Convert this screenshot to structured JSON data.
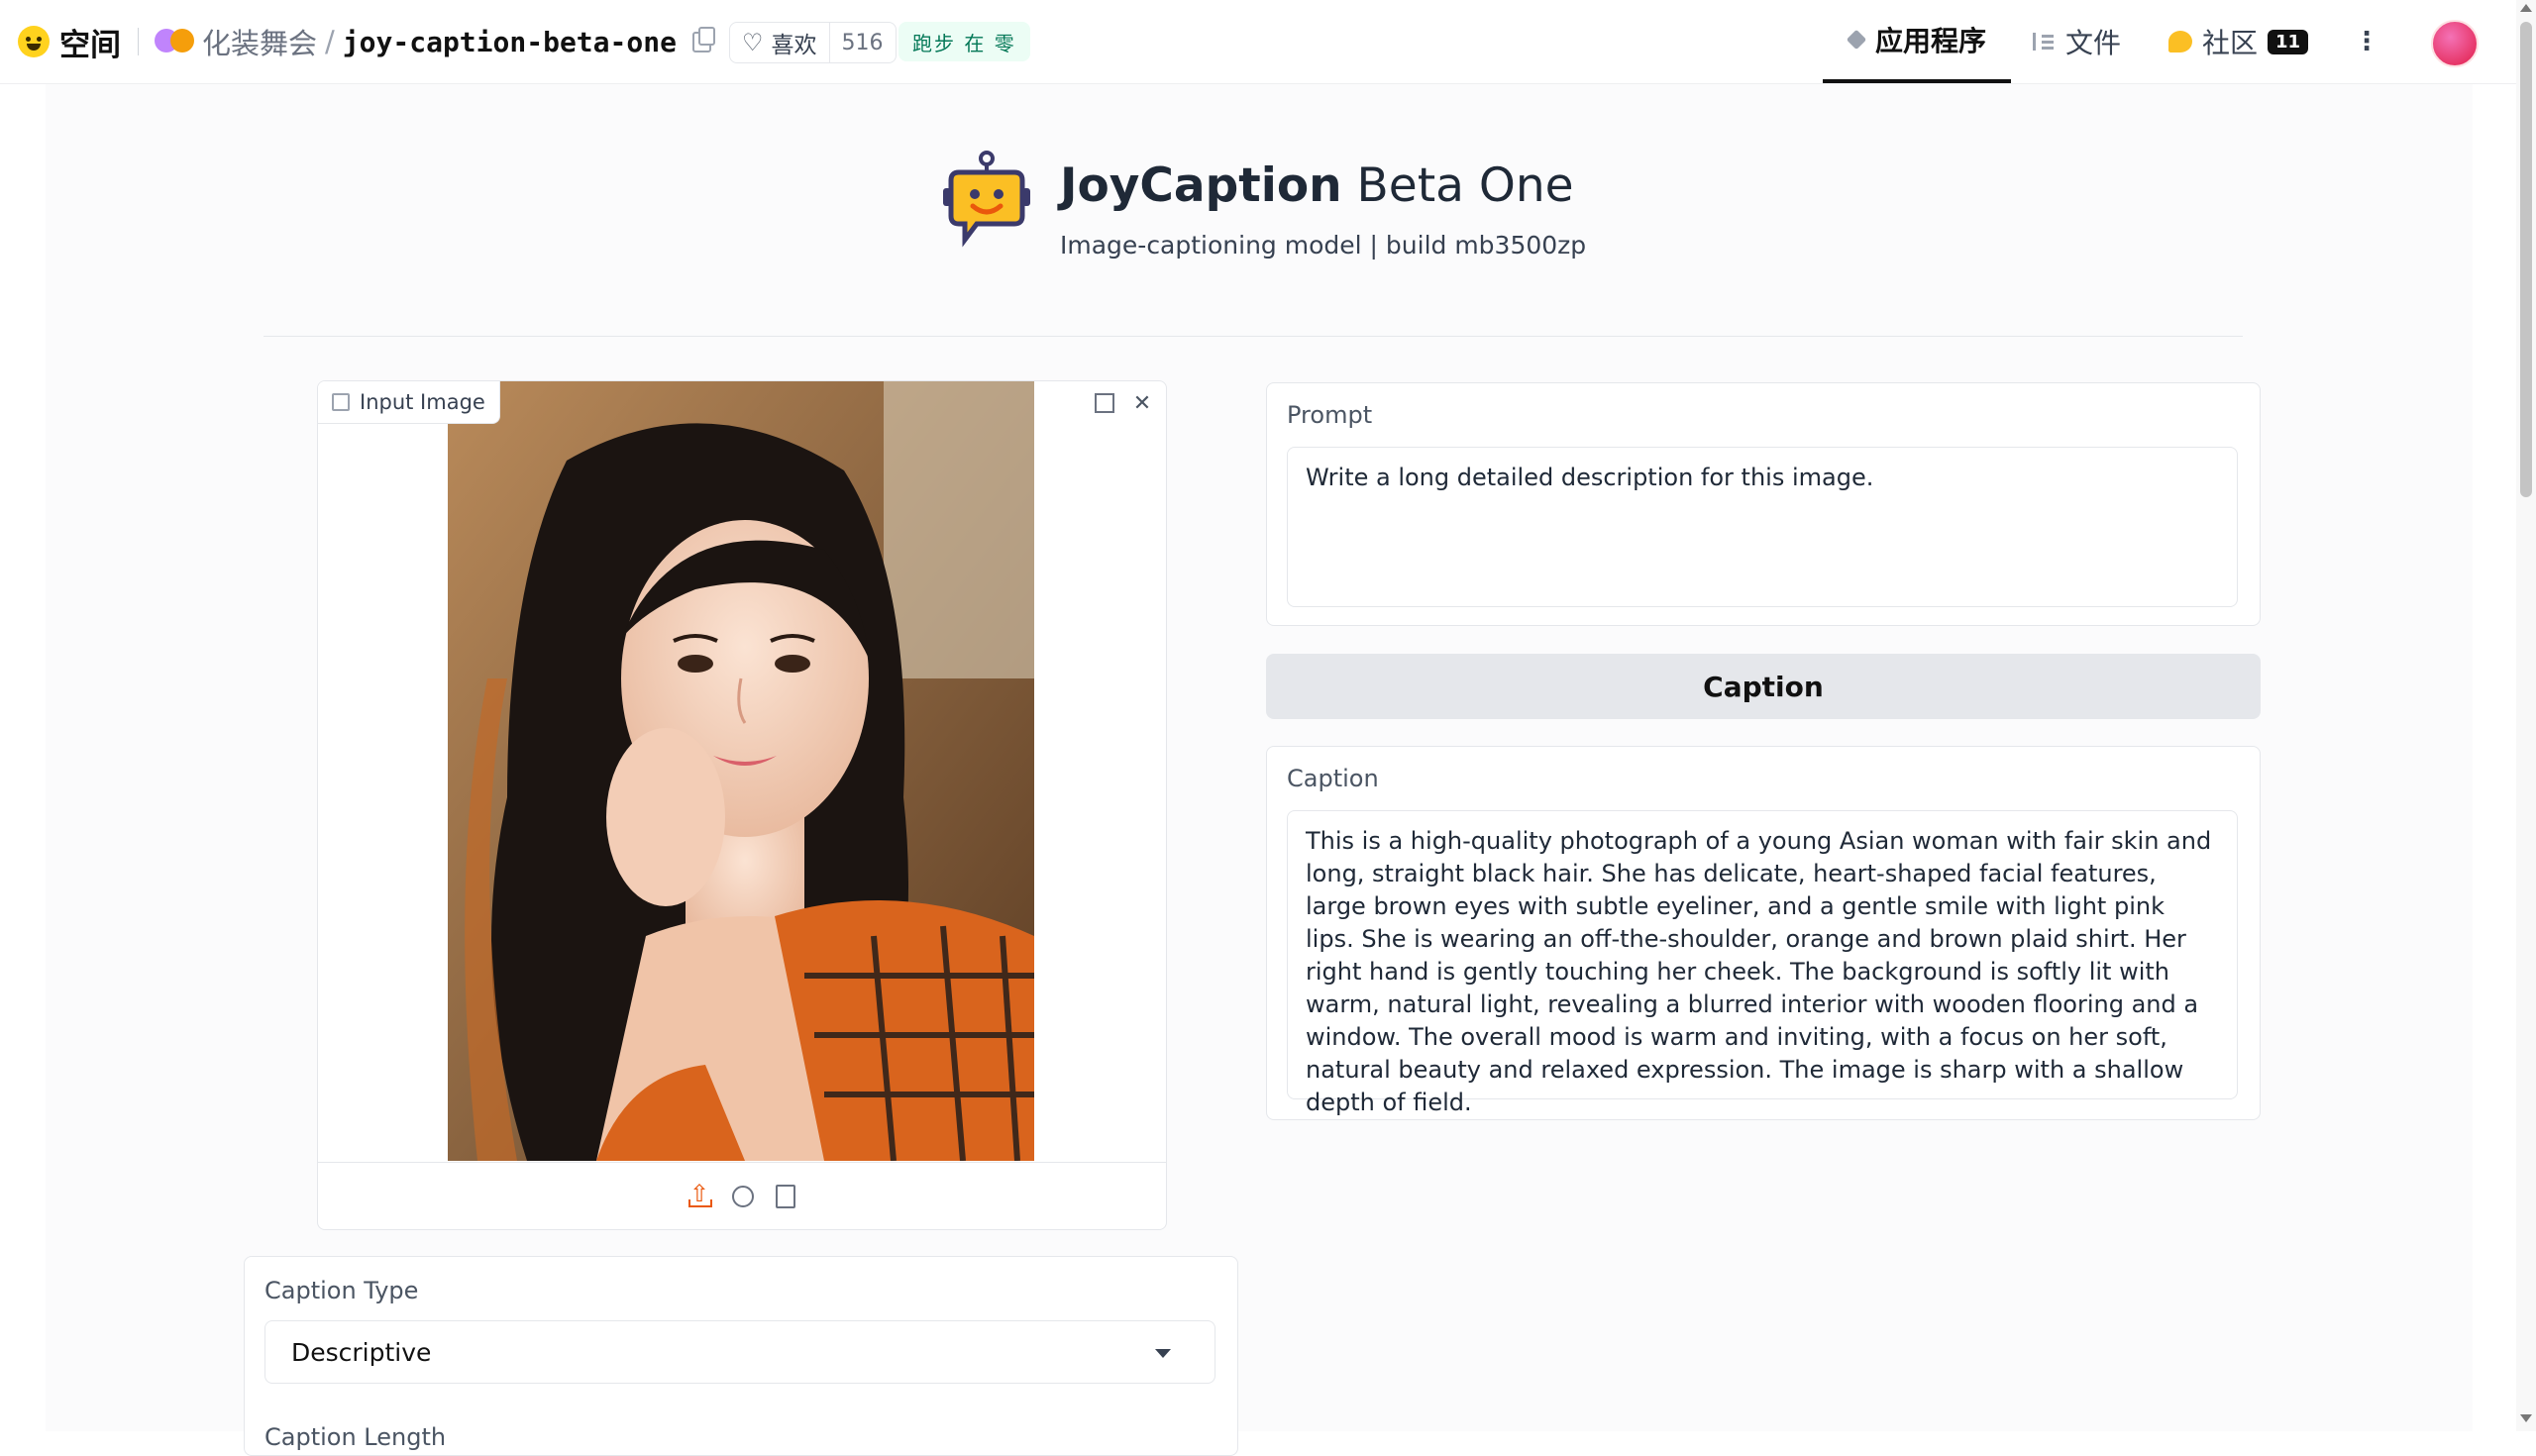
{
  "topbar": {
    "brand_label": "空间",
    "org_name": "化装舞会",
    "separator": "/",
    "repo_name": "joy-caption-beta-one",
    "like_label": "喜欢",
    "like_count": "516",
    "status": "跑步 在 零"
  },
  "nav": {
    "app_label": "应用程序",
    "files_label": "文件",
    "community_label": "社区",
    "community_count": "11",
    "more_label": "⋮"
  },
  "header": {
    "title_bold": "JoyCaption",
    "title_rest": " Beta One",
    "subtitle": "Image-captioning model  |  build mb3500zp"
  },
  "image_input": {
    "label": "Input Image"
  },
  "prompt": {
    "label": "Prompt",
    "value": "Write a long detailed description for this image."
  },
  "caption_button": {
    "label": "Caption"
  },
  "caption_output": {
    "label": "Caption",
    "value": "This is a high-quality photograph of a young Asian woman with fair skin and long, straight black hair. She has delicate, heart-shaped facial features, large brown eyes with subtle eyeliner, and a gentle smile with light pink lips. She is wearing an off-the-shoulder, orange and brown plaid shirt. Her right hand is gently touching her cheek. The background is softly lit with warm, natural light, revealing a blurred interior with wooden flooring and a window. The overall mood is warm and inviting, with a focus on her soft, natural beauty and relaxed expression. The image is sharp with a shallow depth of field."
  },
  "caption_type": {
    "label": "Caption Type",
    "selected": "Descriptive"
  },
  "caption_length": {
    "label": "Caption Length"
  },
  "icons": {
    "brand": "hugging-face-icon",
    "copy": "copy-icon",
    "like": "heart-icon",
    "app": "cube-icon",
    "files": "files-icon",
    "community": "community-icon",
    "upload": "upload-icon",
    "webcam": "webcam-icon",
    "clipboard": "clipboard-icon",
    "fullscreen": "fullscreen-icon",
    "close": "close-icon",
    "dropdown": "caret-down-icon"
  },
  "colors": {
    "accent_orange": "#ea580c",
    "status_green": "#047857",
    "button_gray": "#e5e7eb"
  }
}
